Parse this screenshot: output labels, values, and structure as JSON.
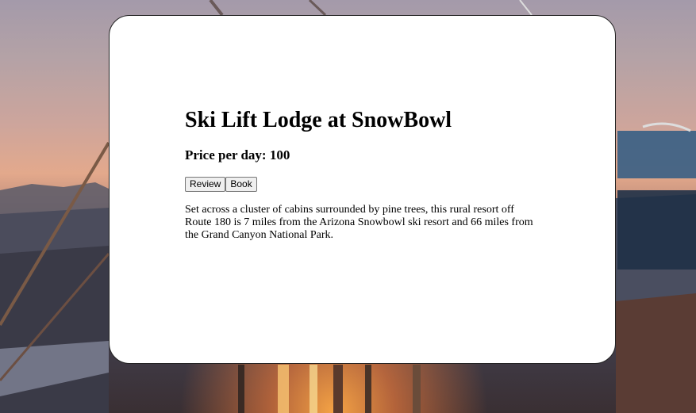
{
  "hotel": {
    "title": "Ski Lift Lodge at SnowBowl",
    "price_text": "Price per day: 100",
    "price_per_day": 100,
    "description": "Set across a cluster of cabins surrounded by pine trees, this rural resort off Route 180 is 7 miles from the Arizona Snowbowl ski resort and 66 miles from the Grand Canyon National Park."
  },
  "actions": {
    "review_label": "Review",
    "book_label": "Book"
  },
  "colors": {
    "card_background": "#ffffff",
    "button_background": "#efefef",
    "button_border": "#767676"
  }
}
